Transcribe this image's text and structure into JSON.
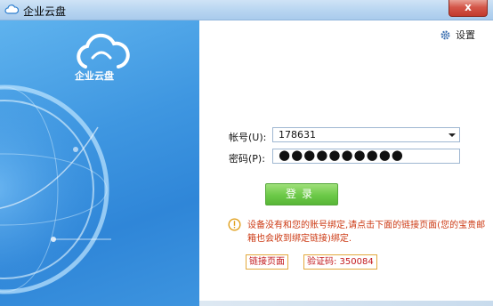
{
  "window": {
    "title": "企业云盘",
    "close_symbol": "x"
  },
  "brand": {
    "logo_text": "企业云盘"
  },
  "settings": {
    "label": "设置"
  },
  "form": {
    "account_label": "帐号(U):",
    "account_value": "178631",
    "password_label": "密码(P):",
    "password_value": "●●●●●●●●●●"
  },
  "login_button": {
    "label": "登录"
  },
  "notice": {
    "text": "设备没有和您的账号绑定,请点击下面的链接页面(您的宝贵邮箱也会收到绑定链接)绑定."
  },
  "badges": {
    "link_page": "链接页面",
    "verification": "验证码: 350084"
  },
  "colors": {
    "accent_blue": "#3f97e1",
    "login_green": "#6cc948",
    "notice_red": "#cc3a14"
  }
}
